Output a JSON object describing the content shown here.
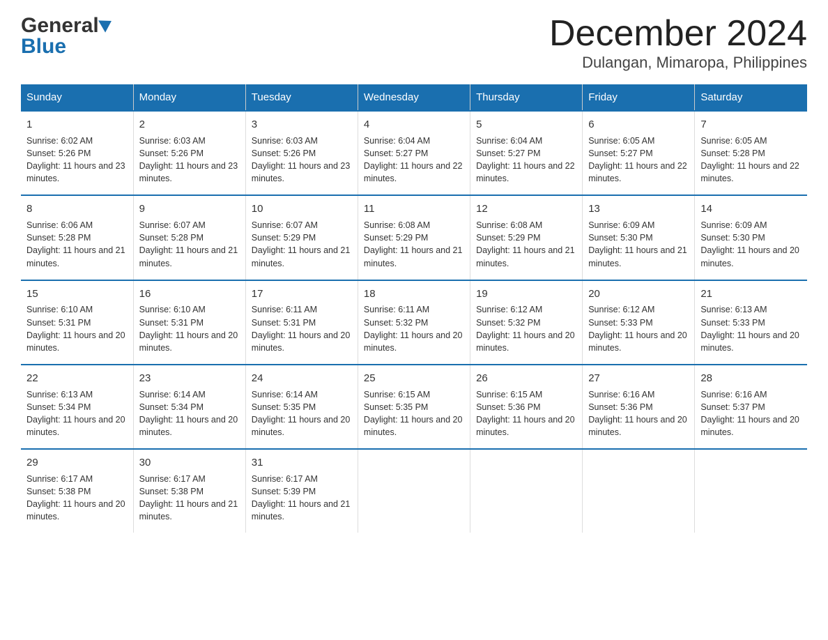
{
  "logo": {
    "general": "General",
    "blue": "Blue"
  },
  "title": "December 2024",
  "subtitle": "Dulangan, Mimaropa, Philippines",
  "days": [
    "Sunday",
    "Monday",
    "Tuesday",
    "Wednesday",
    "Thursday",
    "Friday",
    "Saturday"
  ],
  "weeks": [
    [
      {
        "num": "1",
        "sunrise": "6:02 AM",
        "sunset": "5:26 PM",
        "daylight": "11 hours and 23 minutes."
      },
      {
        "num": "2",
        "sunrise": "6:03 AM",
        "sunset": "5:26 PM",
        "daylight": "11 hours and 23 minutes."
      },
      {
        "num": "3",
        "sunrise": "6:03 AM",
        "sunset": "5:26 PM",
        "daylight": "11 hours and 23 minutes."
      },
      {
        "num": "4",
        "sunrise": "6:04 AM",
        "sunset": "5:27 PM",
        "daylight": "11 hours and 22 minutes."
      },
      {
        "num": "5",
        "sunrise": "6:04 AM",
        "sunset": "5:27 PM",
        "daylight": "11 hours and 22 minutes."
      },
      {
        "num": "6",
        "sunrise": "6:05 AM",
        "sunset": "5:27 PM",
        "daylight": "11 hours and 22 minutes."
      },
      {
        "num": "7",
        "sunrise": "6:05 AM",
        "sunset": "5:28 PM",
        "daylight": "11 hours and 22 minutes."
      }
    ],
    [
      {
        "num": "8",
        "sunrise": "6:06 AM",
        "sunset": "5:28 PM",
        "daylight": "11 hours and 21 minutes."
      },
      {
        "num": "9",
        "sunrise": "6:07 AM",
        "sunset": "5:28 PM",
        "daylight": "11 hours and 21 minutes."
      },
      {
        "num": "10",
        "sunrise": "6:07 AM",
        "sunset": "5:29 PM",
        "daylight": "11 hours and 21 minutes."
      },
      {
        "num": "11",
        "sunrise": "6:08 AM",
        "sunset": "5:29 PM",
        "daylight": "11 hours and 21 minutes."
      },
      {
        "num": "12",
        "sunrise": "6:08 AM",
        "sunset": "5:29 PM",
        "daylight": "11 hours and 21 minutes."
      },
      {
        "num": "13",
        "sunrise": "6:09 AM",
        "sunset": "5:30 PM",
        "daylight": "11 hours and 21 minutes."
      },
      {
        "num": "14",
        "sunrise": "6:09 AM",
        "sunset": "5:30 PM",
        "daylight": "11 hours and 20 minutes."
      }
    ],
    [
      {
        "num": "15",
        "sunrise": "6:10 AM",
        "sunset": "5:31 PM",
        "daylight": "11 hours and 20 minutes."
      },
      {
        "num": "16",
        "sunrise": "6:10 AM",
        "sunset": "5:31 PM",
        "daylight": "11 hours and 20 minutes."
      },
      {
        "num": "17",
        "sunrise": "6:11 AM",
        "sunset": "5:31 PM",
        "daylight": "11 hours and 20 minutes."
      },
      {
        "num": "18",
        "sunrise": "6:11 AM",
        "sunset": "5:32 PM",
        "daylight": "11 hours and 20 minutes."
      },
      {
        "num": "19",
        "sunrise": "6:12 AM",
        "sunset": "5:32 PM",
        "daylight": "11 hours and 20 minutes."
      },
      {
        "num": "20",
        "sunrise": "6:12 AM",
        "sunset": "5:33 PM",
        "daylight": "11 hours and 20 minutes."
      },
      {
        "num": "21",
        "sunrise": "6:13 AM",
        "sunset": "5:33 PM",
        "daylight": "11 hours and 20 minutes."
      }
    ],
    [
      {
        "num": "22",
        "sunrise": "6:13 AM",
        "sunset": "5:34 PM",
        "daylight": "11 hours and 20 minutes."
      },
      {
        "num": "23",
        "sunrise": "6:14 AM",
        "sunset": "5:34 PM",
        "daylight": "11 hours and 20 minutes."
      },
      {
        "num": "24",
        "sunrise": "6:14 AM",
        "sunset": "5:35 PM",
        "daylight": "11 hours and 20 minutes."
      },
      {
        "num": "25",
        "sunrise": "6:15 AM",
        "sunset": "5:35 PM",
        "daylight": "11 hours and 20 minutes."
      },
      {
        "num": "26",
        "sunrise": "6:15 AM",
        "sunset": "5:36 PM",
        "daylight": "11 hours and 20 minutes."
      },
      {
        "num": "27",
        "sunrise": "6:16 AM",
        "sunset": "5:36 PM",
        "daylight": "11 hours and 20 minutes."
      },
      {
        "num": "28",
        "sunrise": "6:16 AM",
        "sunset": "5:37 PM",
        "daylight": "11 hours and 20 minutes."
      }
    ],
    [
      {
        "num": "29",
        "sunrise": "6:17 AM",
        "sunset": "5:38 PM",
        "daylight": "11 hours and 20 minutes."
      },
      {
        "num": "30",
        "sunrise": "6:17 AM",
        "sunset": "5:38 PM",
        "daylight": "11 hours and 21 minutes."
      },
      {
        "num": "31",
        "sunrise": "6:17 AM",
        "sunset": "5:39 PM",
        "daylight": "11 hours and 21 minutes."
      },
      null,
      null,
      null,
      null
    ]
  ],
  "labels": {
    "sunrise": "Sunrise:",
    "sunset": "Sunset:",
    "daylight": "Daylight:"
  }
}
